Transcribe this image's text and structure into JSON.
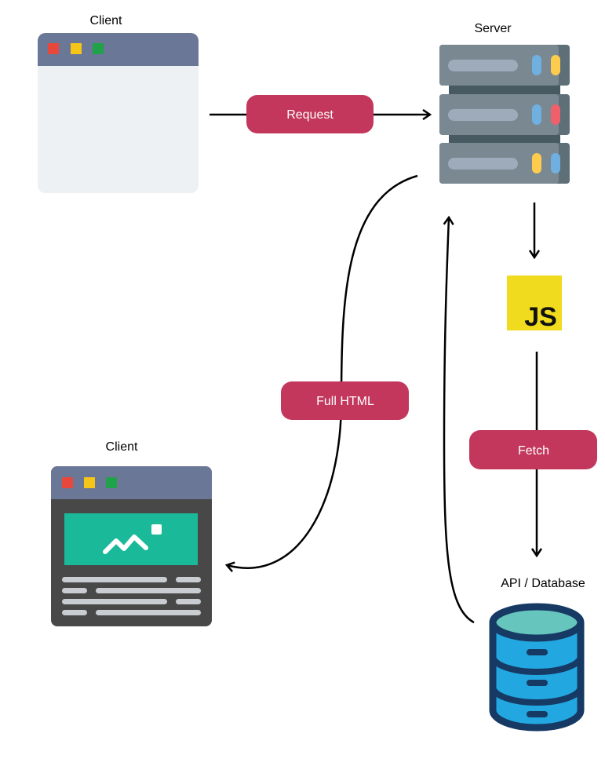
{
  "labels": {
    "client_top": "Client",
    "server": "Server",
    "client_bottom": "Client",
    "database": "API / Database",
    "js": "JS"
  },
  "pills": {
    "request": "Request",
    "full_html": "Full HTML",
    "fetch": "Fetch"
  },
  "colors": {
    "pill": "#c2375b",
    "titlebar": "#6b7796",
    "js": "#f0db1e",
    "db_body": "#22a7e0",
    "db_outline": "#163a63",
    "server": "#7a8892"
  }
}
